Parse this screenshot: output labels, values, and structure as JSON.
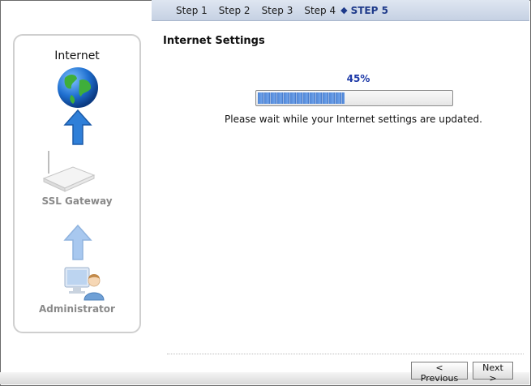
{
  "wizard": {
    "steps": [
      "Step 1",
      "Step 2",
      "Step 3",
      "Step 4"
    ],
    "current_step": "STEP 5"
  },
  "diagram": {
    "internet_label": "Internet",
    "gateway_label": "SSL Gateway",
    "admin_label": "Administrator"
  },
  "main": {
    "title": "Internet Settings",
    "progress_text": "45%",
    "progress_value": 0.45,
    "message": "Please wait while your Internet settings are updated."
  },
  "buttons": {
    "previous": "< Previous",
    "next": "Next >"
  },
  "colors": {
    "progress_fill": "#4f86d6",
    "percent_text": "#1e3aa8",
    "arrow_active": "#2f7fd8",
    "arrow_inactive": "#a8c8ef"
  },
  "icons": [
    "globe-icon",
    "up-arrow-icon",
    "router-icon",
    "up-arrow-icon",
    "administrator-icon"
  ]
}
